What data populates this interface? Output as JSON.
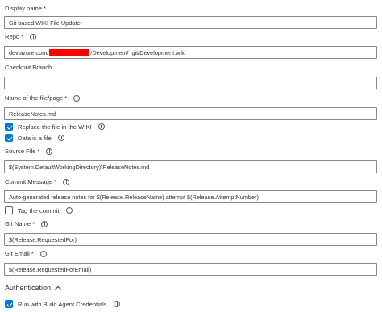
{
  "display_name": {
    "label": "Display name",
    "required_mark": "*",
    "value": "Git based WIKI File Updater"
  },
  "repo": {
    "label": "Repo",
    "required_mark": "*",
    "value_prefix": "dev.azure.com/",
    "value_suffix": "/Development/_git/Development.wiki"
  },
  "checkout_branch": {
    "label": "Checkout Branch",
    "value": ""
  },
  "file_page": {
    "label": "Name of the file/page",
    "required_mark": "*",
    "value": "ReleaseNotes.md"
  },
  "replace_file": {
    "label": "Replace the file in the WIKI",
    "checked": true
  },
  "data_is_file": {
    "label": "Data is a file",
    "checked": true
  },
  "source_file": {
    "label": "Source File",
    "required_mark": "*",
    "value": "$(System.DefaultWorkingDirectory)\\ReleaseNotes.md"
  },
  "commit_message": {
    "label": "Commit Message",
    "required_mark": "*",
    "value": "Auto-generated release notes for $(Release.ReleaseName) attempt $(Release.AttemptNumber)"
  },
  "tag_commit": {
    "label": "Tag the commit",
    "checked": false
  },
  "git_name": {
    "label": "Git Name",
    "required_mark": "*",
    "value": "$(Release.RequestedFor)"
  },
  "git_email": {
    "label": "Git Email",
    "required_mark": "*",
    "value": "$(Release.RequestedForEmail)"
  },
  "authentication": {
    "title": "Authentication"
  },
  "build_agent": {
    "label": "Run with Build Agent Credentials",
    "checked": true
  },
  "colors": {
    "accent": "#0078d4",
    "redaction": "#ff0000",
    "border": "#8a8886",
    "text": "#323130"
  }
}
